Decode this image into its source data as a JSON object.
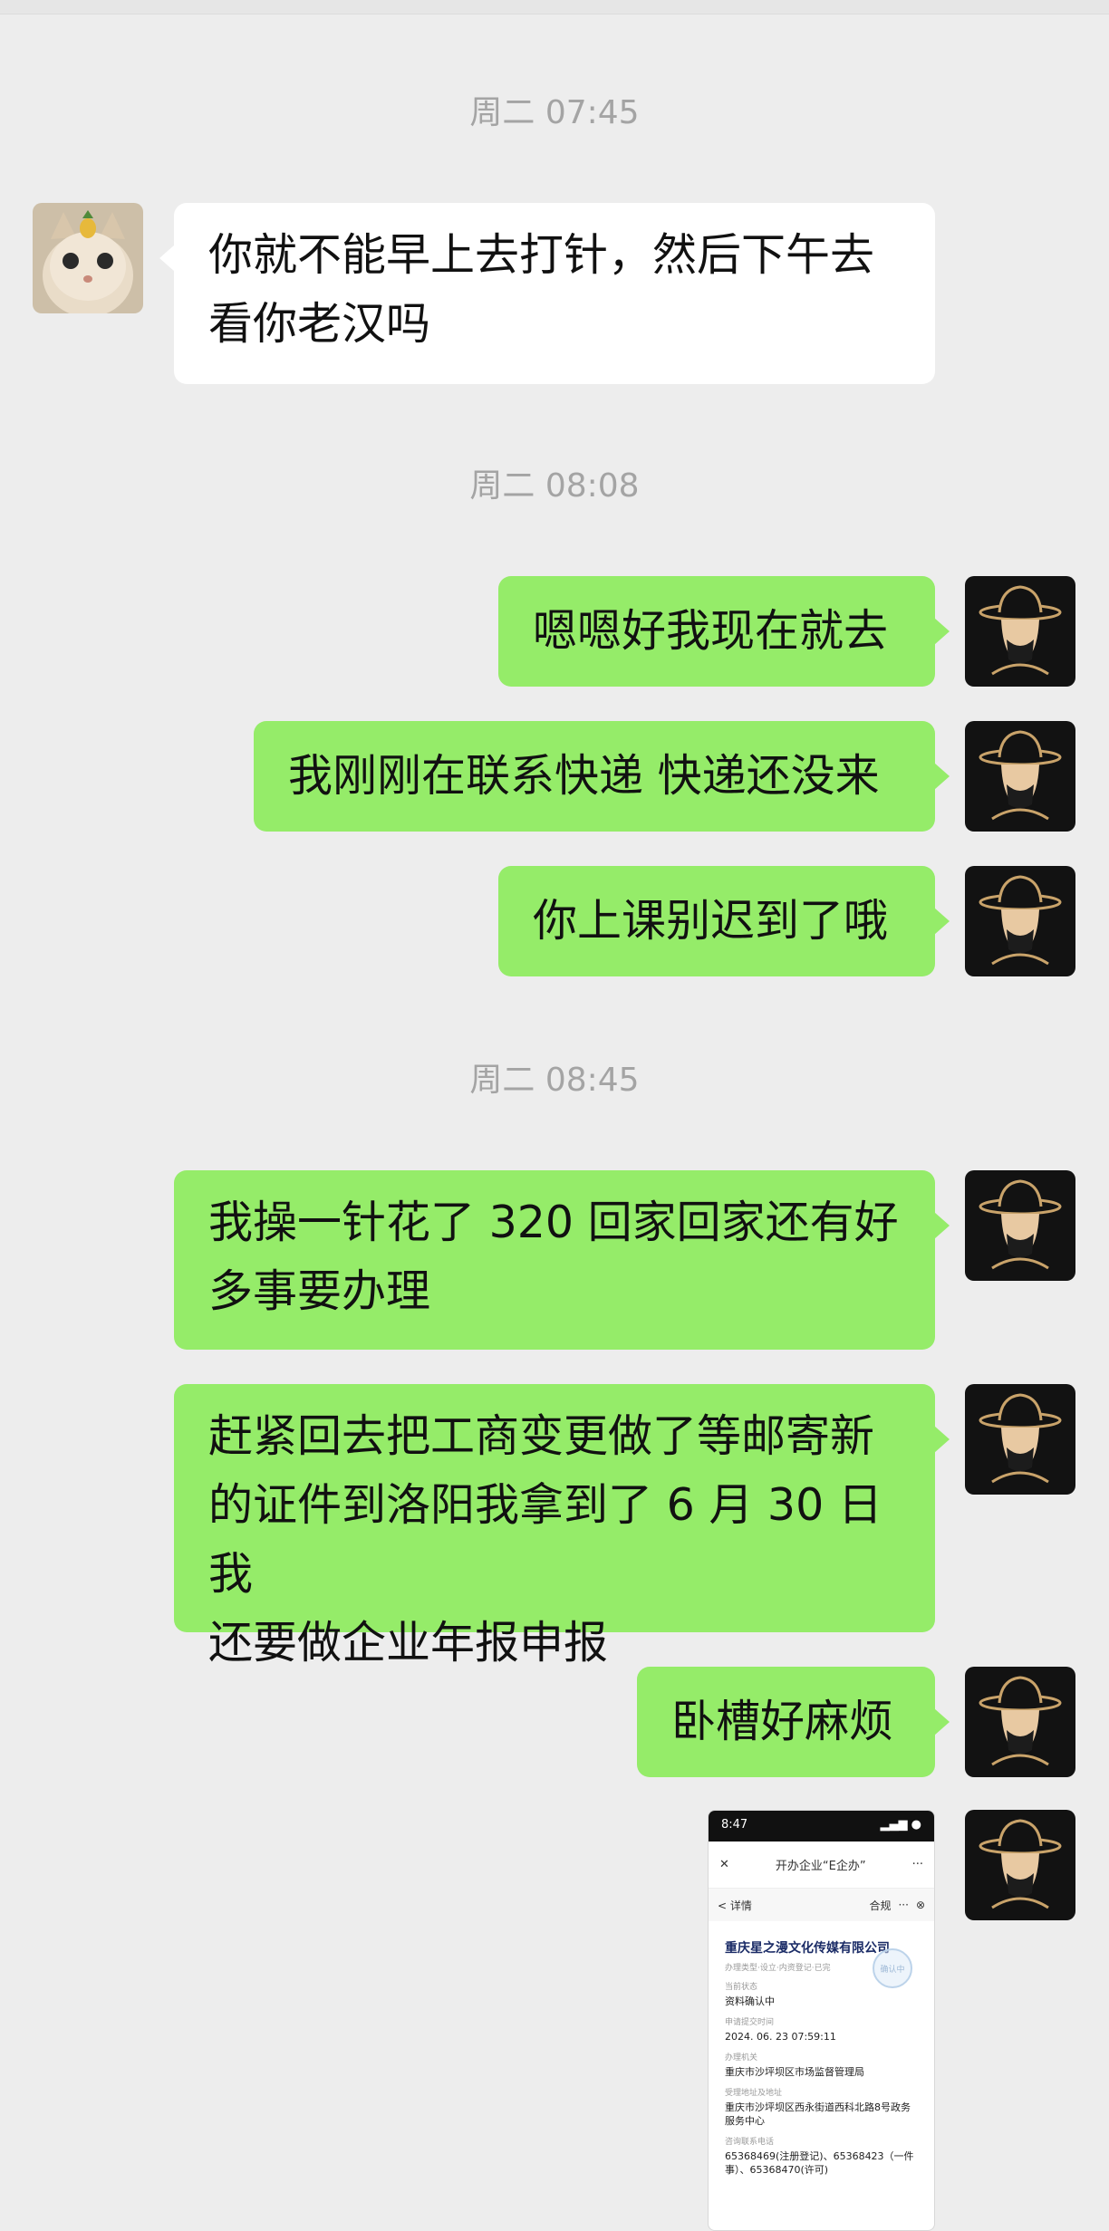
{
  "timestamps": [
    "周二 07:45",
    "周二 08:08",
    "周二 08:45"
  ],
  "messages": [
    {
      "from": "other",
      "lines": [
        "你就不能早上去打针，然后下午去",
        "看你老汉吗"
      ]
    },
    {
      "from": "me",
      "lines": [
        "嗯嗯好我现在就去"
      ]
    },
    {
      "from": "me",
      "lines": [
        "我刚刚在联系快递 快递还没来"
      ]
    },
    {
      "from": "me",
      "lines": [
        "你上课别迟到了哦"
      ]
    },
    {
      "from": "me",
      "lines": [
        "我操一针花了 320 回家回家还有好",
        "多事要办理"
      ]
    },
    {
      "from": "me",
      "lines": [
        "赶紧回去把工商变更做了等邮寄新",
        "的证件到洛阳我拿到了 6 月 30 日我",
        "还要做企业年报申报"
      ]
    },
    {
      "from": "me",
      "lines": [
        "卧槽好麻烦"
      ]
    }
  ],
  "image_message": {
    "status_time": "8:47",
    "nav_title": "开办企业“E企办”",
    "back_label": "< 详情",
    "header_actions": [
      "合规",
      "···",
      "⊗"
    ],
    "company_name": "重庆星之漫文化传媒有限公司",
    "company_sub": "办理类型·设立·内资登记·已完",
    "stamp_text": "确认中",
    "fields": [
      {
        "label": "当前状态",
        "value": "资料确认中"
      },
      {
        "label": "申请提交时间",
        "value": "2024. 06. 23 07:59:11"
      },
      {
        "label": "办理机关",
        "value": "重庆市沙坪坝区市场监督管理局"
      },
      {
        "label": "受理地址及地址",
        "value": "重庆市沙坪坝区西永街道西科北路8号政务服务中心"
      },
      {
        "label": "咨询联系电话",
        "value": "65368469(注册登记)、65368423（一件事）、65368470(许可)"
      }
    ]
  },
  "colors": {
    "background": "#ededed",
    "incoming_bubble": "#ffffff",
    "outgoing_bubble": "#95ec69",
    "timestamp_text": "#a4a4a4"
  },
  "icons": {
    "other_avatar": "cat-avatar",
    "my_avatar": "hat-masked-man-avatar"
  }
}
